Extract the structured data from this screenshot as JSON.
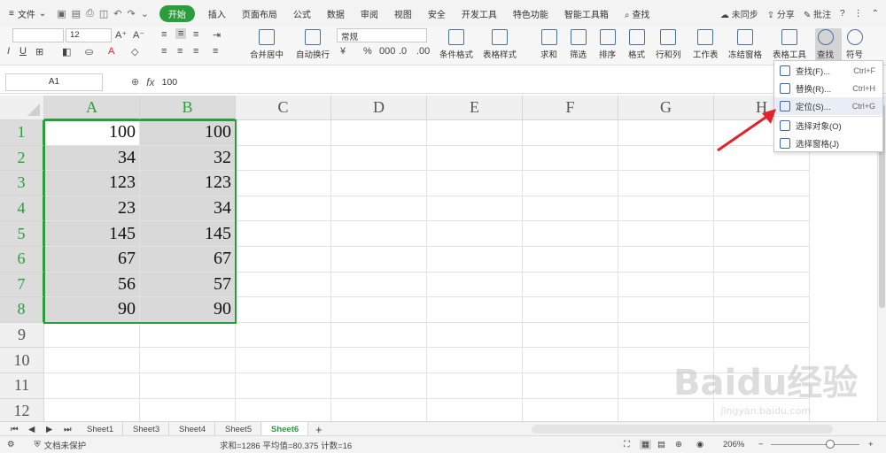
{
  "menubar": {
    "file_label": "文件",
    "tabs": [
      "开始",
      "插入",
      "页面布局",
      "公式",
      "数据",
      "审阅",
      "视图",
      "安全",
      "开发工具",
      "特色功能",
      "智能工具箱",
      "查找"
    ],
    "active_tab": "开始",
    "sync_label": "未同步",
    "share_label": "分享",
    "comment_label": "批注"
  },
  "ribbon": {
    "font_size": "12",
    "number_format": "常规",
    "merge_label": "合并居中",
    "wrap_label": "自动换行",
    "cond_format_label": "条件格式",
    "table_style_label": "表格样式",
    "sum_label": "求和",
    "filter_label": "筛选",
    "sort_label": "排序",
    "format_label": "格式",
    "rowcol_label": "行和列",
    "sheet_label": "工作表",
    "freeze_label": "冻结窗格",
    "table_tools_label": "表格工具",
    "find_label": "查找",
    "symbol_label": "符号"
  },
  "formula": {
    "cell_ref": "A1",
    "fx": "fx",
    "value": "100"
  },
  "grid": {
    "columns": [
      "A",
      "B",
      "C",
      "D",
      "E",
      "F",
      "G",
      "H"
    ],
    "rows": [
      "1",
      "2",
      "3",
      "4",
      "5",
      "6",
      "7",
      "8",
      "9",
      "10",
      "11",
      "12"
    ],
    "colA": [
      "100",
      "34",
      "123",
      "23",
      "145",
      "67",
      "56",
      "90"
    ],
    "colB": [
      "100",
      "32",
      "123",
      "34",
      "145",
      "67",
      "57",
      "90"
    ]
  },
  "dropdown": {
    "items": [
      {
        "label": "查找(F)...",
        "shortcut": "Ctrl+F"
      },
      {
        "label": "替换(R)...",
        "shortcut": "Ctrl+H"
      },
      {
        "label": "定位(S)...",
        "shortcut": "Ctrl+G"
      },
      {
        "label": "选择对象(O)",
        "shortcut": ""
      },
      {
        "label": "选择窗格(J)",
        "shortcut": ""
      }
    ]
  },
  "sheets": [
    "Sheet1",
    "Sheet3",
    "Sheet4",
    "Sheet5",
    "Sheet6"
  ],
  "active_sheet": "Sheet6",
  "status": {
    "protect_label": "文档未保护",
    "stats": "求和=1286  平均值=80.375  计数=16",
    "zoom": "206%"
  },
  "watermark": {
    "main": "Baidu经验",
    "sub": "jingyan.baidu.com"
  },
  "colors": {
    "accent_green": "#2a9d3c",
    "arrow_red": "#e0242b"
  }
}
